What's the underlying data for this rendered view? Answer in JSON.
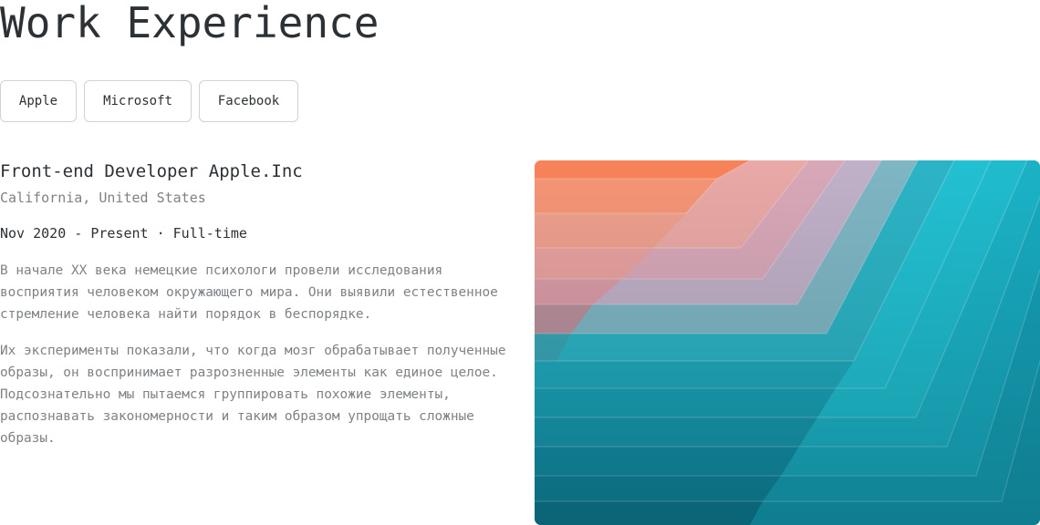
{
  "header": {
    "title": "Work Experience"
  },
  "tabs": [
    {
      "label": "Apple"
    },
    {
      "label": "Microsoft"
    },
    {
      "label": "Facebook"
    }
  ],
  "job": {
    "title": "Front-end Developer Apple.Inc",
    "location": "California, United States",
    "dates": "Nov 2020 - Present · Full-time",
    "paragraphs": [
      "В начале XX века немецкие психологи провели исследования восприятия человеком окружающего мира. Они выявили естественное стремление человека найти порядок в беспорядке.",
      "Их эксперименты показали, что когда мозг обрабатывает полученные образы, он воспринимает разрозненные элементы как единое целое. Подсознательно мы пытаемся группировать похожие элементы, распознавать закономерности и таким образом упрощать сложные образы."
    ]
  },
  "colors": {
    "text": "#2c3136",
    "muted": "#7d8287",
    "border": "#cfd3d6",
    "image_warm": "#f58c6a",
    "image_teal": "#1cb8c8"
  }
}
